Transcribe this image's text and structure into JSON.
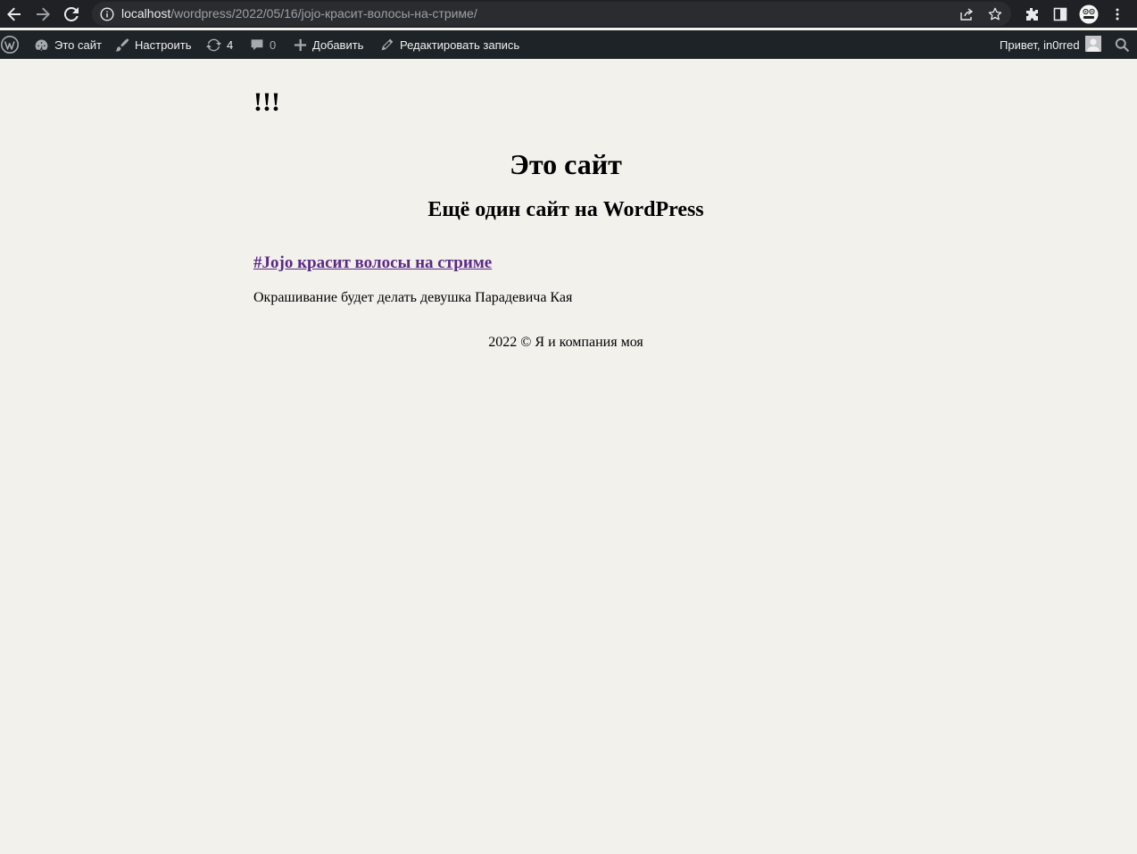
{
  "browser": {
    "url_host": "localhost",
    "url_path": "/wordpress/2022/05/16/jojo-красит-волосы-на-стриме/",
    "icons": [
      "back-arrow-icon",
      "forward-arrow-icon",
      "reload-icon",
      "info-icon",
      "share-icon",
      "star-icon",
      "extensions-icon",
      "side-panel-icon",
      "profile-avatar",
      "menu-icon"
    ]
  },
  "adminbar": {
    "site_label": "Это сайт",
    "customize_label": "Настроить",
    "updates_count": "4",
    "comments_count": "0",
    "new_label": "Добавить",
    "edit_label": "Редактировать запись",
    "greeting": "Привет, in0rred"
  },
  "page": {
    "site_mark": "!!!",
    "site_title": "Это сайт",
    "site_description": "Ещё один сайт на WordPress",
    "post_title": "#Jojo красит волосы на стриме ",
    "post_excerpt": "Окрашивание будет делать девушка Парадевича Кая",
    "footer": "2022 © Я и компания моя"
  },
  "colors": {
    "background": "#f2f1ec",
    "adminbar": "#1d2327",
    "link_visited": "#5b2a86",
    "chrome": "#202124"
  }
}
